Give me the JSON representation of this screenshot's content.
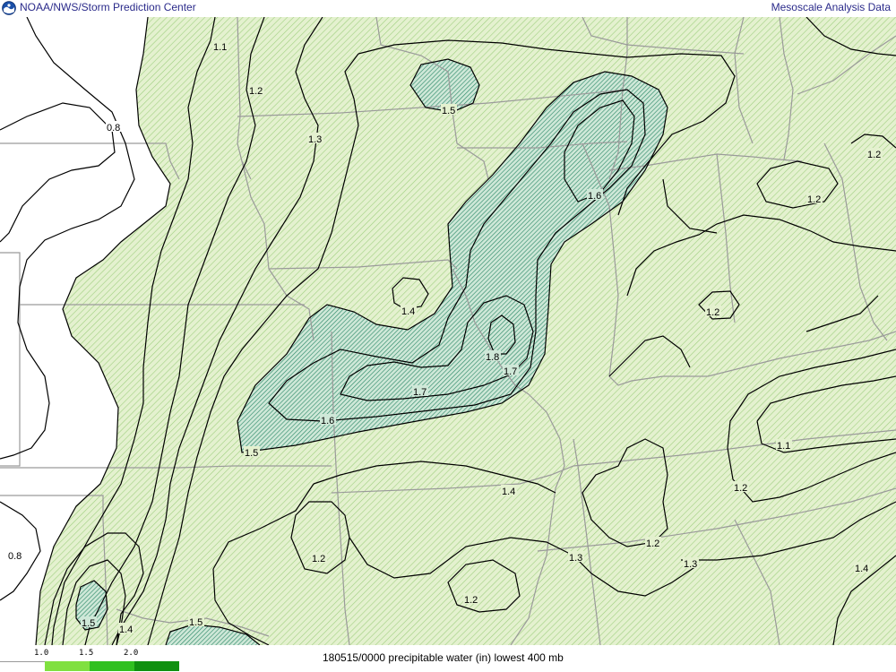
{
  "header": {
    "source": "NOAA/NWS/Storm Prediction Center",
    "product": "Mesoscale Analysis Data"
  },
  "footer": {
    "caption": "180515/0000 precipitable water (in) lowest 400 mb"
  },
  "colorbar": {
    "ticks": [
      "1.0",
      "1.5",
      "2.0"
    ],
    "swatch_colors": [
      "#ffffff",
      "#80e040",
      "#30c020",
      "#109010"
    ]
  },
  "colors": {
    "fill_light": "#e4f1cf",
    "hatch_light": "#9fcf7f",
    "fill_dark": "#cfe8d8",
    "hatch_dark": "#2f8a6a",
    "contour": "#000000",
    "borders": "#9a9a9a",
    "header_text": "#2a2a8a"
  },
  "contour_labels": {
    "l01": "1.1",
    "l02": "1.2",
    "l03": "1.3",
    "l04": "0.8",
    "l05": "1.5",
    "l06": "1.6",
    "l07": "1.2",
    "l08": "1.2",
    "l09": "1.4",
    "l10": "1.2",
    "l11": "1.8",
    "l12": "1.7",
    "l13": "1.7",
    "l14": "1.6",
    "l15": "1.5",
    "l16": "1.1",
    "l17": "1.2",
    "l18": "1.4",
    "l19": "1.2",
    "l20": "1.3",
    "l21": "1.2",
    "l22": "1.3",
    "l23": "1.4",
    "l24": "1.2",
    "l25": "0.8",
    "l26": "1.5",
    "l27": "1.4",
    "l28": "1.5"
  }
}
